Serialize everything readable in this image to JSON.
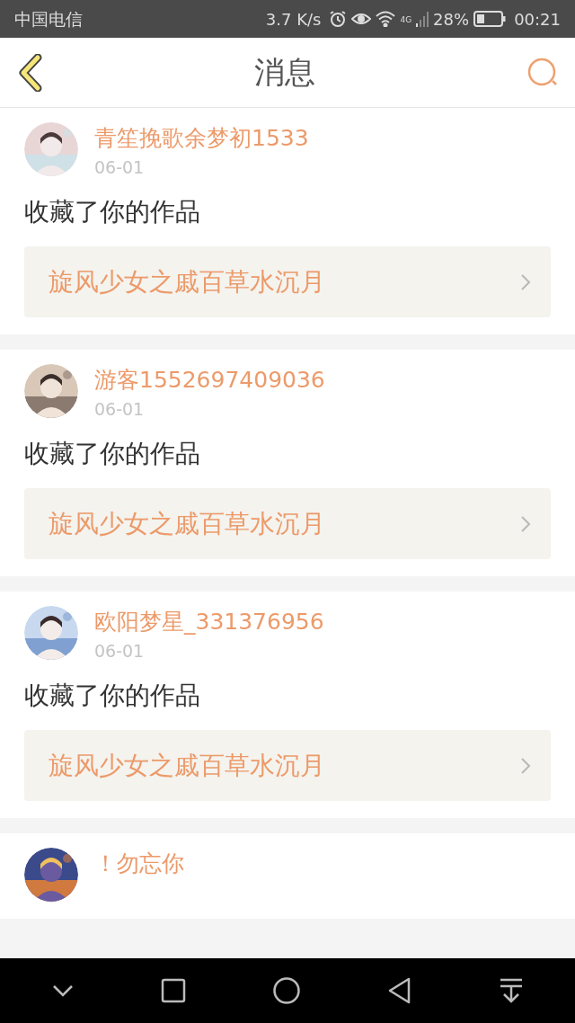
{
  "status_bar": {
    "carrier": "中国电信",
    "speed": "3.7 K/s",
    "network": "4G",
    "battery": "28%",
    "time": "00:21"
  },
  "header": {
    "title": "消息"
  },
  "messages": [
    {
      "name": "青笙挽歌余梦初1533",
      "date": "06-01",
      "action": "收藏了你的作品",
      "work": "旋风少女之戚百草水沉月"
    },
    {
      "name": "游客1552697409036",
      "date": "06-01",
      "action": "收藏了你的作品",
      "work": "旋风少女之戚百草水沉月"
    },
    {
      "name": "欧阳梦星_331376956",
      "date": "06-01",
      "action": "收藏了你的作品",
      "work": "旋风少女之戚百草水沉月"
    },
    {
      "name": "！勿忘你"
    }
  ]
}
